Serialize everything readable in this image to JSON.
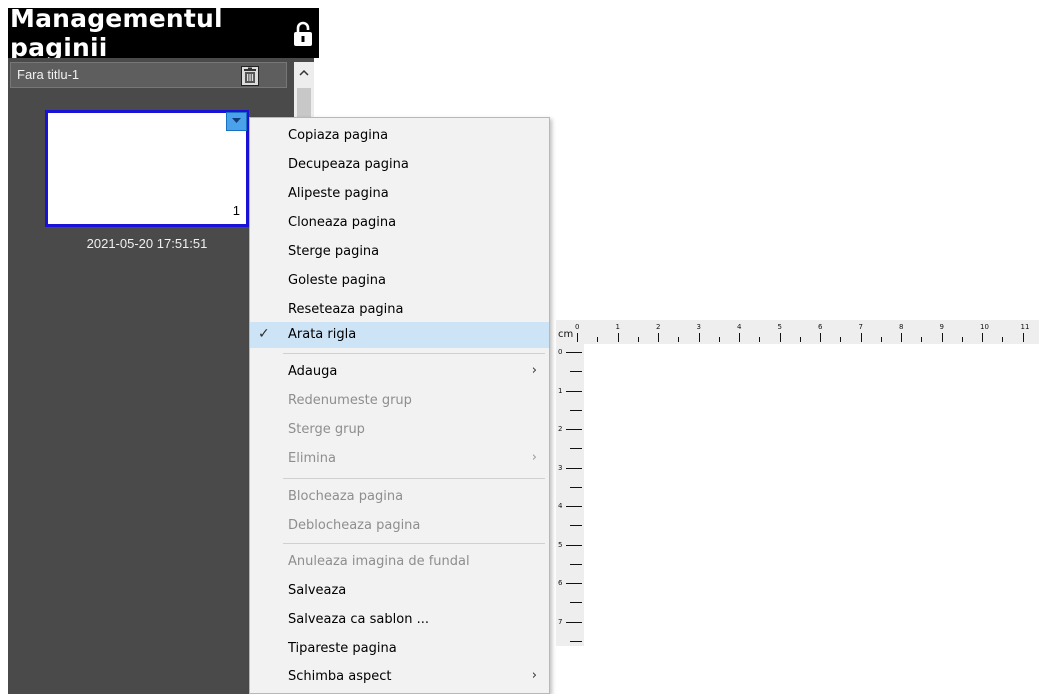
{
  "header": {
    "title": "Managementul paginii",
    "lock_icon": "unlocked-padlock-icon"
  },
  "panel": {
    "group_name": "Fara titlu-1",
    "trash_icon": "trash-icon",
    "scroll_up_icon": "chevron-up-icon",
    "page": {
      "number": "1",
      "timestamp": "2021-05-20 17:51:51",
      "dropdown_icon": "dropdown-arrow-icon"
    }
  },
  "menu": {
    "items": [
      {
        "label": "Copiaza pagina",
        "enabled": true
      },
      {
        "label": "Decupeaza pagina",
        "enabled": true
      },
      {
        "label": "Alipeste pagina",
        "enabled": true
      },
      {
        "label": "Cloneaza pagina",
        "enabled": true
      },
      {
        "label": "Sterge pagina",
        "enabled": true
      },
      {
        "label": "Goleste pagina",
        "enabled": true
      },
      {
        "label": "Reseteaza pagina",
        "enabled": true
      },
      {
        "label": "Arata rigla",
        "enabled": true,
        "checked": true,
        "highlighted": true
      },
      {
        "label": "Adauga",
        "enabled": true,
        "submenu": true
      },
      {
        "label": "Redenumeste grup",
        "enabled": false
      },
      {
        "label": "Sterge grup",
        "enabled": false
      },
      {
        "label": "Elimina",
        "enabled": false,
        "submenu": true
      },
      {
        "label": "Blocheaza pagina",
        "enabled": false
      },
      {
        "label": "Deblocheaza pagina",
        "enabled": false
      },
      {
        "label": "Anuleaza imagina de fundal",
        "enabled": false
      },
      {
        "label": "Salveaza",
        "enabled": true
      },
      {
        "label": "Salveaza ca sablon ...",
        "enabled": true
      },
      {
        "label": "Tipareste pagina",
        "enabled": true
      },
      {
        "label": "Schimba aspect",
        "enabled": true,
        "submenu": true
      }
    ],
    "check_icon": "checkmark-icon",
    "submenu_icon": "chevron-right-icon"
  },
  "ruler": {
    "unit": "cm",
    "h_labels": [
      "0",
      "1",
      "2",
      "3",
      "4",
      "5",
      "6",
      "7",
      "8",
      "9",
      "10",
      "11"
    ],
    "v_labels": [
      "0",
      "1",
      "2",
      "3",
      "4",
      "5",
      "6",
      "7"
    ]
  },
  "colors": {
    "panel_bg": "#4a4a4a",
    "selection_border": "#1a12d8",
    "menu_highlight": "#cde4f7"
  }
}
